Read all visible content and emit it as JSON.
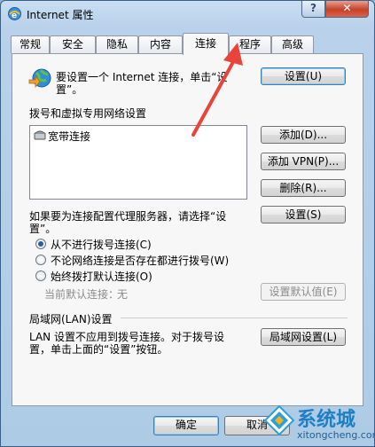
{
  "window": {
    "title": "Internet 属性",
    "help_label": "?",
    "close_label": "✕"
  },
  "tabs": [
    {
      "label": "常规"
    },
    {
      "label": "安全"
    },
    {
      "label": "隐私"
    },
    {
      "label": "内容"
    },
    {
      "label": "连接"
    },
    {
      "label": "程序"
    },
    {
      "label": "高级"
    }
  ],
  "connection": {
    "setup_text_1": "要设置一个 Internet 连接，单击“设",
    "setup_text_2": "置”。",
    "setup_button": "设置(U)",
    "dialup_header": "拨号和虚拟专用网络设置",
    "list_item": "宽带连接",
    "add_button": "添加(D)...",
    "add_vpn_button": "添加 VPN(P)...",
    "remove_button": "删除(R)...",
    "proxy_text_1": "如果要为连接配置代理服务器，请选择“设",
    "proxy_text_2": "置”。",
    "settings_button": "设置(S)",
    "radio_never": "从不进行拨号连接(C)",
    "radio_when_no_net": "不论网络连接是否存在都进行拨号(W)",
    "radio_always": "始终拨打默认连接(O)",
    "current_default_label": "当前默认连接：",
    "current_default_value": "无",
    "set_default_button": "设置默认值(E)",
    "lan_header": "局域网(LAN)设置",
    "lan_text_1": "LAN 设置不应用到拨号连接。对于拨号设",
    "lan_text_2": "置，单击上面的“设置”按钮。",
    "lan_button": "局域网设置(L)"
  },
  "footer": {
    "ok_button": "确定",
    "cancel_button": "取消"
  },
  "watermark": {
    "brand": "系统城",
    "url": "xitongcheng.com"
  },
  "colors": {
    "annotation_arrow": "#e8443a",
    "radio_dot": "#2a5f98"
  }
}
